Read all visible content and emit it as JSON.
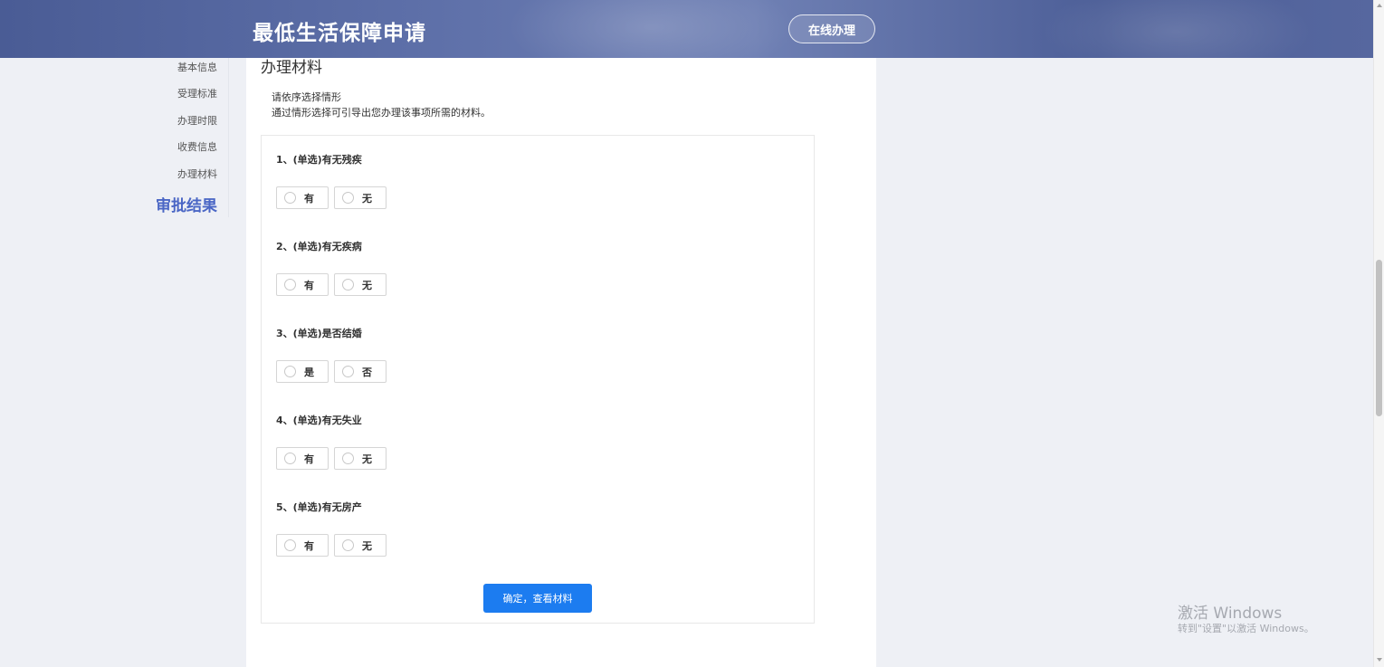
{
  "header": {
    "title": "最低生活保障申请",
    "online_button": "在线办理"
  },
  "sidebar": {
    "items": [
      {
        "label": "基本信息"
      },
      {
        "label": "受理标准"
      },
      {
        "label": "办理时限"
      },
      {
        "label": "收费信息"
      },
      {
        "label": "办理材料"
      },
      {
        "label": "审批结果",
        "active": true
      }
    ]
  },
  "main": {
    "section_title": "办理材料",
    "hint_line1": "请依序选择情形",
    "hint_line2": "通过情形选择可引导出您办理该事项所需的材料。",
    "questions": [
      {
        "label": "1、(单选)有无残疾",
        "options": [
          "有",
          "无"
        ]
      },
      {
        "label": "2、(单选)有无疾病",
        "options": [
          "有",
          "无"
        ]
      },
      {
        "label": "3、(单选)是否结婚",
        "options": [
          "是",
          "否"
        ]
      },
      {
        "label": "4、(单选)有无失业",
        "options": [
          "有",
          "无"
        ]
      },
      {
        "label": "5、(单选)有无房产",
        "options": [
          "有",
          "无"
        ]
      }
    ],
    "confirm_button": "确定，查看材料"
  },
  "watermark": {
    "line1": "激活 Windows",
    "line2": "转到\"设置\"以激活 Windows。"
  }
}
